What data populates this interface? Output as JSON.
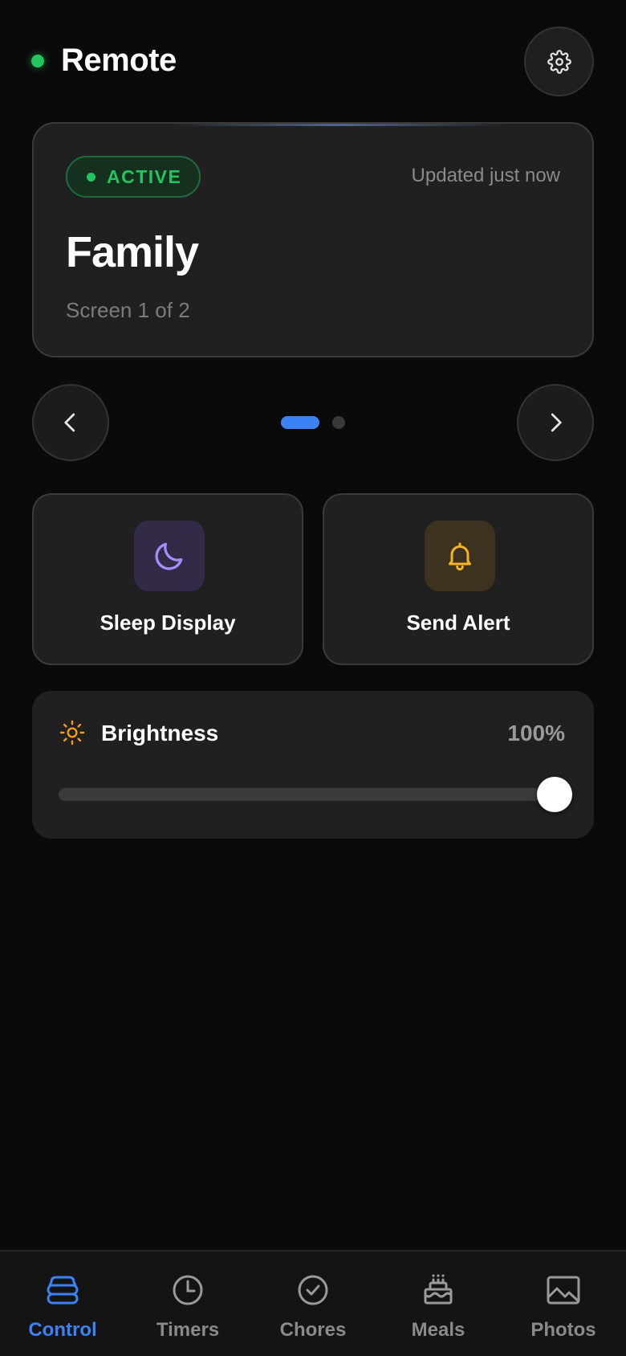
{
  "header": {
    "title": "Remote",
    "connection_status": "connected",
    "status_color": "#22c55e"
  },
  "current_screen": {
    "status": "ACTIVE",
    "updated": "Updated just now",
    "name": "Family",
    "index_text": "Screen 1 of 2"
  },
  "pager": {
    "current_page": 1,
    "total_pages": 2
  },
  "actions": {
    "sleep_label": "Sleep Display",
    "sleep_icon": "moon-icon",
    "alert_label": "Send Alert",
    "alert_icon": "bell-icon"
  },
  "brightness": {
    "label": "Brightness",
    "value_text": "100%",
    "level": 1.0,
    "icon": "sun-icon"
  },
  "bottom_nav": {
    "items": [
      {
        "label": "Control",
        "icon": "layers-icon",
        "active": true
      },
      {
        "label": "Timers",
        "icon": "clock-icon",
        "active": false
      },
      {
        "label": "Chores",
        "icon": "check-circle-icon",
        "active": false
      },
      {
        "label": "Meals",
        "icon": "cake-icon",
        "active": false
      },
      {
        "label": "Photos",
        "icon": "image-icon",
        "active": false
      }
    ]
  },
  "colors": {
    "accent": "#3b82f6",
    "active_green": "#22c55e",
    "moon": "#a78bfa",
    "bell": "#f5b521",
    "sun": "#f59e0b"
  }
}
